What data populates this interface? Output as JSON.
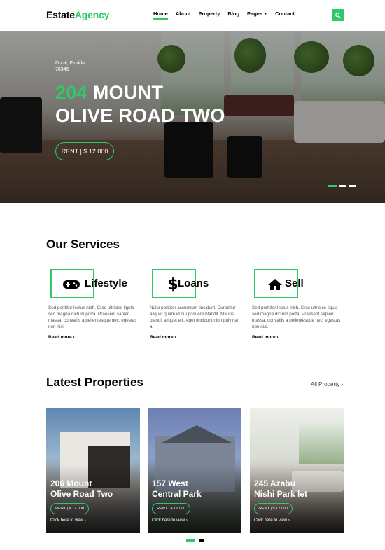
{
  "brand": {
    "part1": "Estate",
    "part2": "Agency"
  },
  "nav": {
    "items": [
      "Home",
      "About",
      "Property",
      "Blog",
      "Pages",
      "Contact"
    ],
    "active": "Home",
    "search_icon": "search-icon"
  },
  "colors": {
    "accent": "#2eca6a",
    "text": "#000000"
  },
  "hero": {
    "location_line1": "Doral, Florida",
    "location_line2": "78345",
    "title_num": "204",
    "title_rest1": "MOUNT",
    "title_line2": "OLIVE ROAD TWO",
    "rent": "RENT | $ 12.000"
  },
  "services": {
    "title": "Our Services",
    "items": [
      {
        "name": "Lifestyle",
        "icon": "gamepad-icon",
        "text": "Sed porttitor lectus nibh. Cras ultricies ligula sed magna dictum porta. Praesent sapien massa, convallis a pellentesque nec, egestas non nisi.",
        "more": "Read more"
      },
      {
        "name": "Loans",
        "icon": "dollar-icon",
        "text": "Nulla porttitor accumsan tincidunt. Curabitur aliquet quam id dui posuere blandit. Mauris blandit aliquet elit, eget tincidunt nibh pulvinar a.",
        "more": "Read more"
      },
      {
        "name": "Sell",
        "icon": "home-icon",
        "text": "Sed porttitor lectus nibh. Cras ultricies ligula sed magna dictum porta. Praesent sapien massa, convallis a pellentesque nec, egestas non nisi.",
        "more": "Read more"
      }
    ]
  },
  "properties": {
    "title": "Latest Properties",
    "all_link": "All Property",
    "cards": [
      {
        "line1": "206 Mount",
        "line2": "Olive Road Two",
        "rent": "RENT | $ 12.000",
        "link": "Click here to view"
      },
      {
        "line1": "157 West",
        "line2": "Central Park",
        "rent": "RENT | $ 12.000",
        "link": "Click here to view"
      },
      {
        "line1": "245 Azabu",
        "line2": "Nishi Park let",
        "rent": "RENT | $ 12.000",
        "link": "Click here to view"
      }
    ]
  }
}
